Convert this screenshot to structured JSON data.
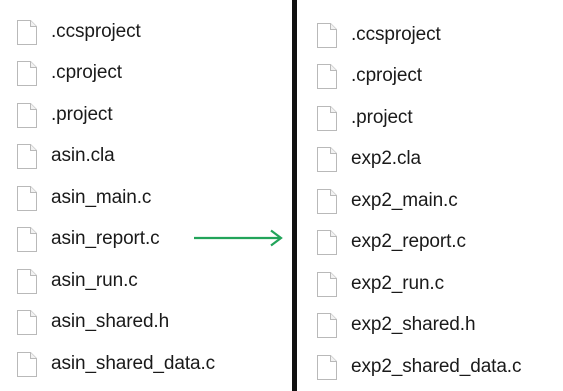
{
  "left_list": {
    "files": [
      {
        "name": ".ccsproject",
        "icon": "file-icon"
      },
      {
        "name": ".cproject",
        "icon": "file-icon"
      },
      {
        "name": ".project",
        "icon": "file-icon"
      },
      {
        "name": "asin.cla",
        "icon": "file-icon"
      },
      {
        "name": "asin_main.c",
        "icon": "file-icon"
      },
      {
        "name": "asin_report.c",
        "icon": "file-icon"
      },
      {
        "name": "asin_run.c",
        "icon": "file-icon"
      },
      {
        "name": "asin_shared.h",
        "icon": "file-icon"
      },
      {
        "name": "asin_shared_data.c",
        "icon": "file-icon"
      }
    ]
  },
  "right_list": {
    "files": [
      {
        "name": ".ccsproject",
        "icon": "file-icon"
      },
      {
        "name": ".cproject",
        "icon": "file-icon"
      },
      {
        "name": ".project",
        "icon": "file-icon"
      },
      {
        "name": "exp2.cla",
        "icon": "file-icon"
      },
      {
        "name": "exp2_main.c",
        "icon": "file-icon"
      },
      {
        "name": "exp2_report.c",
        "icon": "file-icon"
      },
      {
        "name": "exp2_run.c",
        "icon": "file-icon"
      },
      {
        "name": "exp2_shared.h",
        "icon": "file-icon"
      },
      {
        "name": "exp2_shared_data.c",
        "icon": "file-icon"
      }
    ]
  },
  "colors": {
    "arrow": "#22a45a",
    "divider": "#111111",
    "icon_border": "#b9b9b9",
    "text": "#1a1a1a"
  }
}
